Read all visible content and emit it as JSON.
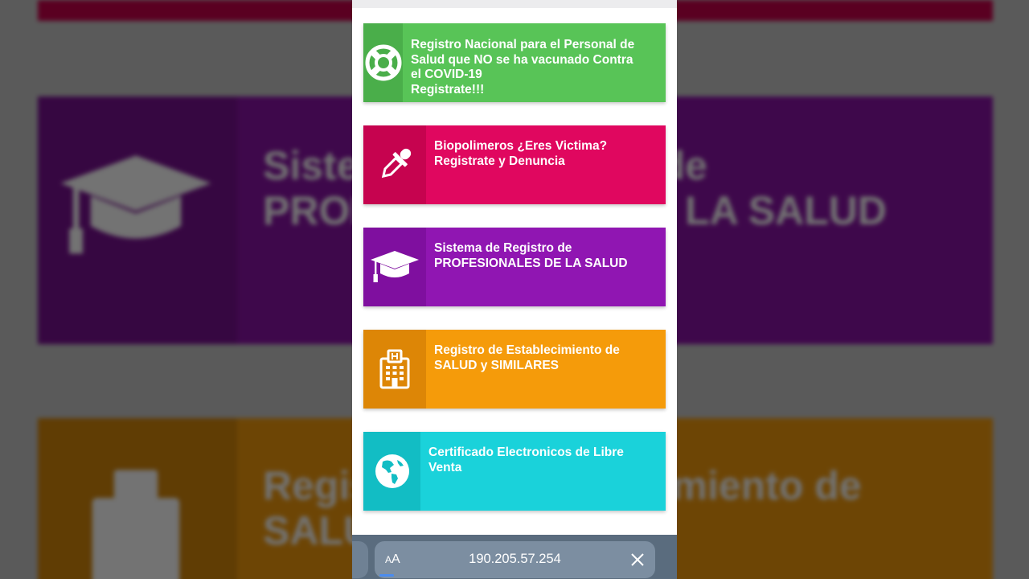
{
  "cards": [
    {
      "icon": "lifebuoy-icon",
      "lines": [
        "Registro Nacional para el Personal de",
        "Salud que NO se ha vacunado Contra",
        "el COVID-19",
        "Registrate!!!"
      ]
    },
    {
      "icon": "dropper-icon",
      "lines": [
        "Biopolimeros ¿Eres Victima?",
        "Registrate y Denuncia"
      ]
    },
    {
      "icon": "graduation-cap-icon",
      "lines": [
        "Sistema de Registro de",
        "PROFESIONALES DE LA SALUD"
      ]
    },
    {
      "icon": "hospital-icon",
      "lines": [
        "Registro de Establecimiento de",
        "SALUD y SIMILARES"
      ]
    },
    {
      "icon": "globe-icon",
      "lines": [
        "Certificado Electronicos de Libre",
        "Venta"
      ]
    }
  ],
  "browser": {
    "text_size_small": "A",
    "text_size_large": "A",
    "url": "190.205.57.254"
  },
  "colors": {
    "green": "#58c457",
    "pink": "#e0075f",
    "purple": "#9016b2",
    "orange": "#f59b0a",
    "cyan": "#1ad2da"
  }
}
